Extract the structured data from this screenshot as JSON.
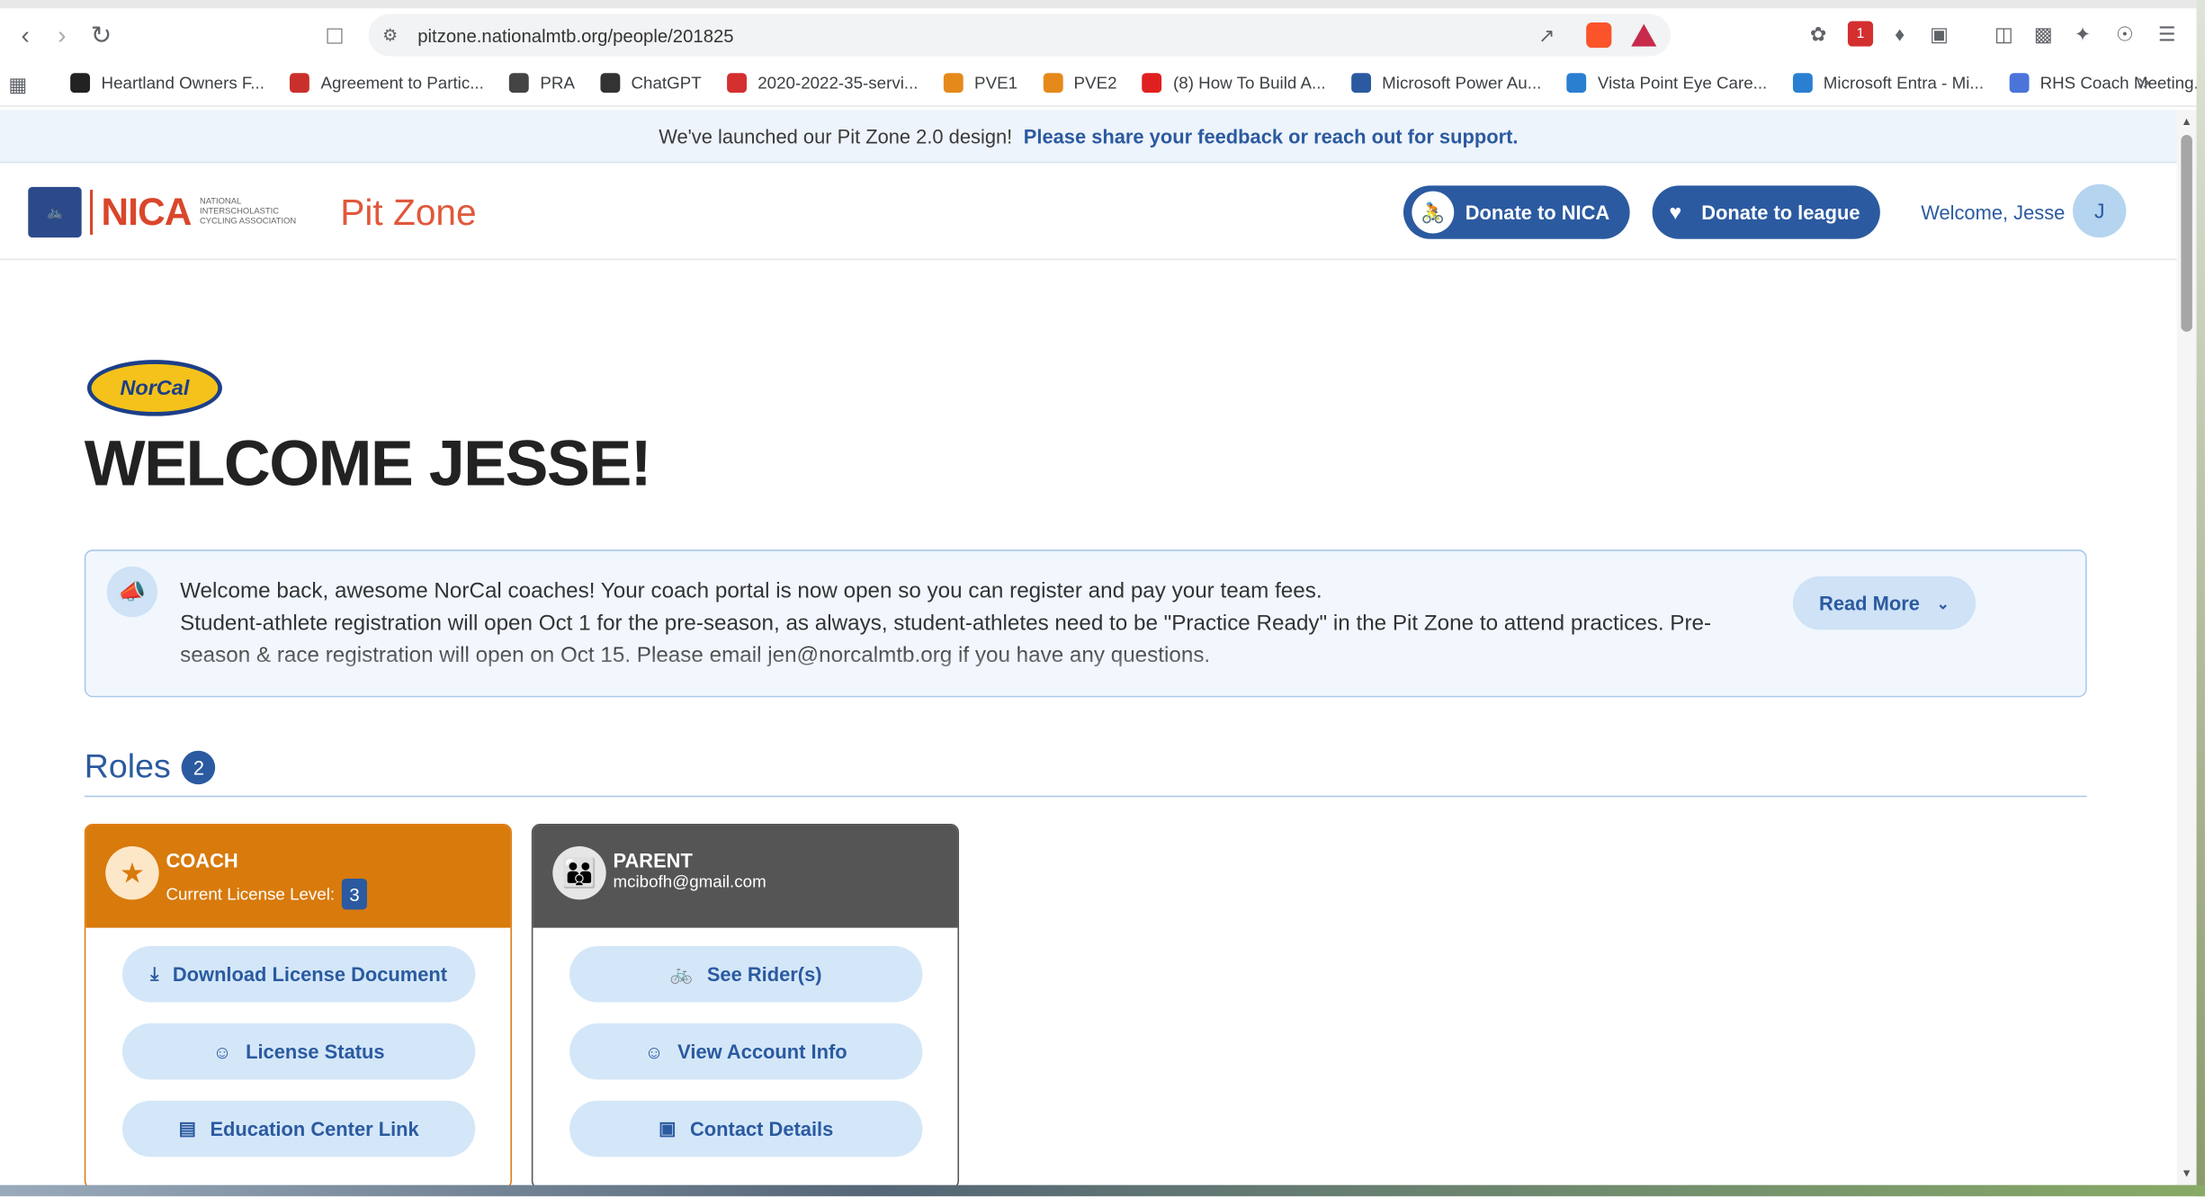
{
  "browser": {
    "url": "pitzone.nationalmtb.org/people/201825",
    "bookmarks": [
      {
        "label": "Heartland Owners F...",
        "color": "#222222"
      },
      {
        "label": "Agreement to Partic...",
        "color": "#c9302c"
      },
      {
        "label": "PRA",
        "color": "#444444"
      },
      {
        "label": "ChatGPT",
        "color": "#333333"
      },
      {
        "label": "2020-2022-35-servi...",
        "color": "#d32f2f"
      },
      {
        "label": "PVE1",
        "color": "#e5891b"
      },
      {
        "label": "PVE2",
        "color": "#e5891b"
      },
      {
        "label": "(8) How To Build A...",
        "color": "#e02020"
      },
      {
        "label": "Microsoft Power Au...",
        "color": "#2b5aa0"
      },
      {
        "label": "Vista Point Eye Care...",
        "color": "#2b7fd0"
      },
      {
        "label": "Microsoft Entra - Mi...",
        "color": "#2b7fd0"
      },
      {
        "label": "RHS Coach Meeting...",
        "color": "#4a74d9"
      }
    ],
    "more_bookmarks": "»"
  },
  "banner": {
    "text": "We've launched our Pit Zone 2.0 design!",
    "link": "Please share your feedback or reach out for support."
  },
  "header": {
    "nica_text": "NICA",
    "nica_sub": "NATIONAL INTERSCHOLASTIC CYCLING ASSOCIATION",
    "app_name": "Pit Zone",
    "donate_nica": "Donate to NICA",
    "donate_league": "Donate to league",
    "welcome": "Welcome, Jesse",
    "avatar_initial": "J"
  },
  "main": {
    "league_logo_text": "NorCal",
    "title": "WELCOME JESSE!",
    "notice": {
      "line1": "Welcome back, awesome NorCal coaches! Your coach portal is now open so you can register and pay your team fees.",
      "line2": "Student-athlete registration will open Oct 1 for the pre-season, as always, student-athletes need to be \"Practice Ready\" in the Pit Zone to attend practices. Pre-season & race registration will open on Oct 15. Please email jen@norcalmtb.org if you have any questions.",
      "read_more": "Read More"
    },
    "roles": {
      "label": "Roles",
      "count": "2",
      "coach": {
        "title": "COACH",
        "subtitle": "Current License Level:",
        "level": "3",
        "buttons": [
          "Download License Document",
          "License Status",
          "Education Center Link"
        ]
      },
      "parent": {
        "title": "PARENT",
        "email": "mcibofh@gmail.com",
        "buttons": [
          "See Rider(s)",
          "View Account Info",
          "Contact Details"
        ]
      }
    }
  },
  "colors": {
    "primary": "#2b5aa0",
    "coach": "#d87a0c",
    "parent": "#555555",
    "nica_red": "#d9462b"
  }
}
